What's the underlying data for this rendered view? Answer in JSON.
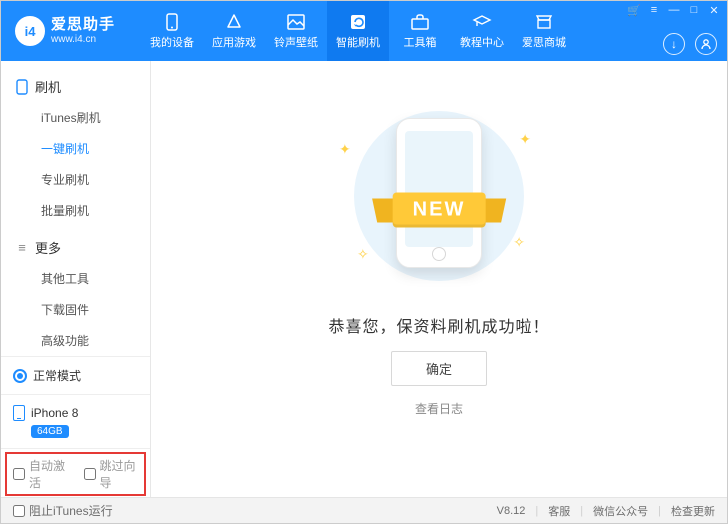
{
  "brand": {
    "logo_text": "i4",
    "title": "爱思助手",
    "subtitle": "www.i4.cn"
  },
  "nav": [
    {
      "label": "我的设备"
    },
    {
      "label": "应用游戏"
    },
    {
      "label": "铃声壁纸"
    },
    {
      "label": "智能刷机"
    },
    {
      "label": "工具箱"
    },
    {
      "label": "教程中心"
    },
    {
      "label": "爱思商城"
    }
  ],
  "sidebar": {
    "group1": {
      "title": "刷机",
      "items": [
        "iTunes刷机",
        "一键刷机",
        "专业刷机",
        "批量刷机"
      ]
    },
    "group2": {
      "title": "更多",
      "items": [
        "其他工具",
        "下载固件",
        "高级功能"
      ]
    },
    "mode": "正常模式",
    "device": "iPhone 8",
    "storage": "64GB",
    "opts": {
      "auto_activate": "自动激活",
      "skip_guide": "跳过向导"
    }
  },
  "main": {
    "ribbon": "NEW",
    "success": "恭喜您，保资料刷机成功啦！",
    "ok": "确定",
    "log": "查看日志"
  },
  "status": {
    "block_itunes": "阻止iTunes运行",
    "version": "V8.12",
    "support": "客服",
    "wechat": "微信公众号",
    "update": "检查更新"
  }
}
